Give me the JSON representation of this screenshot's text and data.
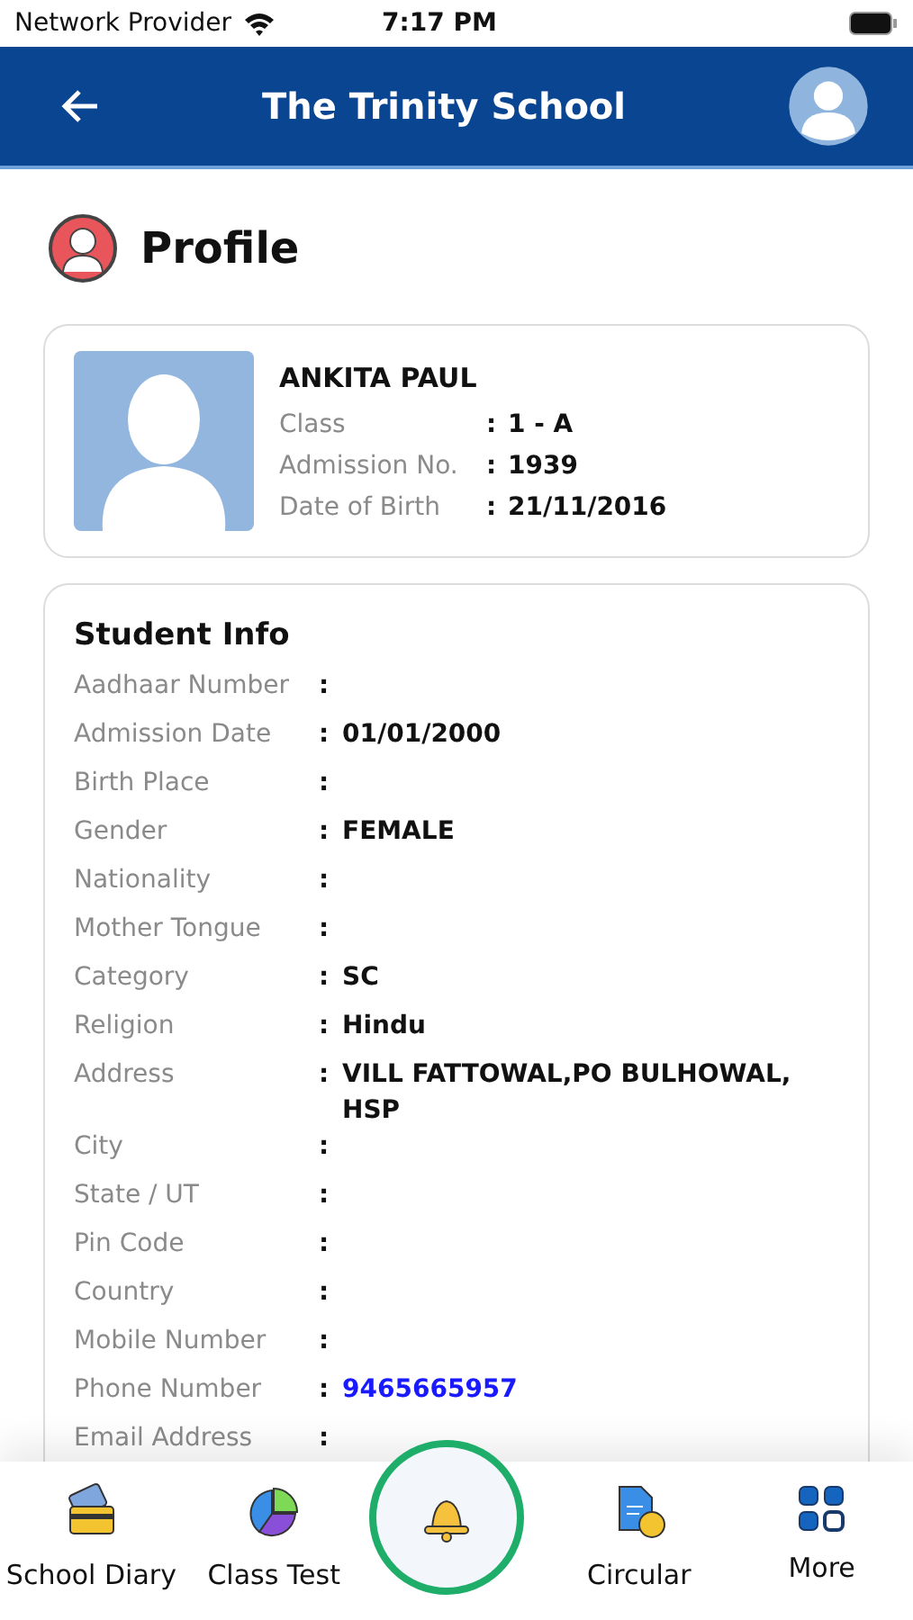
{
  "status_bar": {
    "carrier": "Network Provider",
    "time": "7:17 PM"
  },
  "header": {
    "title": "The Trinity School"
  },
  "page_title": "Profile",
  "student": {
    "name": "ANKITA PAUL",
    "fields": [
      {
        "label": "Class",
        "separator": ":",
        "value": "1 - A"
      },
      {
        "label": "Admission No.",
        "separator": ":",
        "value": "1939"
      },
      {
        "label": "Date of Birth",
        "separator": ":",
        "value": "21/11/2016"
      }
    ]
  },
  "student_info": {
    "title": "Student Info",
    "rows": [
      {
        "label": "Aadhaar Number",
        "separator": ":"
      },
      {
        "label": "Admission Date",
        "separator": ":",
        "value": "01/01/2000"
      },
      {
        "label": "Birth Place",
        "separator": ":"
      },
      {
        "label": "Gender",
        "separator": ":",
        "value": "FEMALE"
      },
      {
        "label": "Nationality",
        "separator": ":"
      },
      {
        "label": "Mother Tongue",
        "separator": ":"
      },
      {
        "label": "Category",
        "separator": ":",
        "value": "SC"
      },
      {
        "label": "Religion",
        "separator": ":",
        "value": "Hindu"
      },
      {
        "label": "Address",
        "separator": ":",
        "value": "VILL FATTOWAL,PO BULHOWAL, HSP"
      },
      {
        "label": "City",
        "separator": ":"
      },
      {
        "label": "State / UT",
        "separator": ":"
      },
      {
        "label": "Pin Code",
        "separator": ":"
      },
      {
        "label": "Country",
        "separator": ":"
      },
      {
        "label": "Mobile Number",
        "separator": ":"
      },
      {
        "label": "Phone Number",
        "separator": ":",
        "value": "9465665957",
        "kind": "link"
      },
      {
        "label": "Email Address",
        "separator": ":"
      }
    ]
  },
  "bottom_nav": [
    {
      "label": "School Diary",
      "kind": "diary"
    },
    {
      "label": "Class Test",
      "kind": "test"
    },
    {
      "kind": "bell"
    },
    {
      "label": "Circular",
      "kind": "circular"
    },
    {
      "label": "More",
      "kind": "more"
    }
  ]
}
